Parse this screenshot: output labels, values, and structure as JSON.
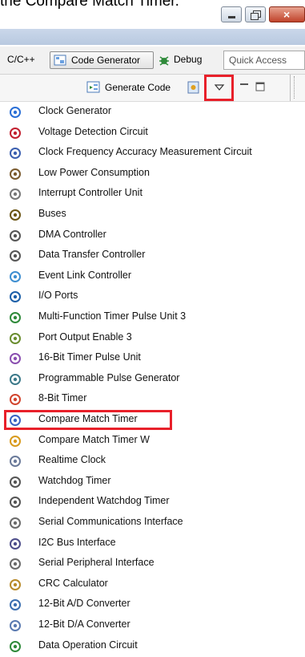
{
  "caption": "the Compare Match Timer.",
  "toolbar": {
    "perspective_cpp": "C/C++",
    "perspective_codegen": "Code Generator",
    "perspective_debug": "Debug",
    "quick_access": "Quick Access",
    "generate_code": "Generate Code"
  },
  "menu": {
    "items": [
      {
        "label": "Clock Generator",
        "icon": "clock-generator-icon",
        "color": "#2a6fd6"
      },
      {
        "label": "Voltage Detection Circuit",
        "icon": "voltage-detection-icon",
        "color": "#c21f2f"
      },
      {
        "label": "Clock Frequency Accuracy Measurement Circuit",
        "icon": "clock-frequency-icon",
        "color": "#3b5fb0"
      },
      {
        "label": "Low Power Consumption",
        "icon": "low-power-icon",
        "color": "#7a5a2e"
      },
      {
        "label": "Interrupt Controller Unit",
        "icon": "interrupt-controller-icon",
        "color": "#777777"
      },
      {
        "label": "Buses",
        "icon": "buses-icon",
        "color": "#6b5514"
      },
      {
        "label": "DMA Controller",
        "icon": "dma-controller-icon",
        "color": "#555555"
      },
      {
        "label": "Data Transfer Controller",
        "icon": "data-transfer-icon",
        "color": "#555555"
      },
      {
        "label": "Event Link Controller",
        "icon": "event-link-icon",
        "color": "#3e8ed0"
      },
      {
        "label": "I/O Ports",
        "icon": "io-ports-icon",
        "color": "#1c5fa8"
      },
      {
        "label": "Multi-Function Timer Pulse Unit 3",
        "icon": "mtu3-timer-icon",
        "color": "#2f8a3a"
      },
      {
        "label": "Port Output Enable 3",
        "icon": "port-output-icon",
        "color": "#6a8d2f"
      },
      {
        "label": "16-Bit Timer Pulse Unit",
        "icon": "tpu-timer-icon",
        "color": "#8a4fb0"
      },
      {
        "label": "Programmable Pulse Generator",
        "icon": "ppg-icon",
        "color": "#3c7a8a"
      },
      {
        "label": "8-Bit Timer",
        "icon": "8bit-timer-icon",
        "color": "#d2452e"
      },
      {
        "label": "Compare Match Timer",
        "icon": "cmt-timer-icon",
        "color": "#3a63c4"
      },
      {
        "label": "Compare Match Timer W",
        "icon": "cmtw-timer-icon",
        "color": "#d99a1c"
      },
      {
        "label": "Realtime Clock",
        "icon": "realtime-clock-icon",
        "color": "#6a7a9a"
      },
      {
        "label": "Watchdog Timer",
        "icon": "watchdog-icon",
        "color": "#555555"
      },
      {
        "label": "Independent Watchdog Timer",
        "icon": "independent-watchdog-icon",
        "color": "#555555"
      },
      {
        "label": "Serial Communications Interface",
        "icon": "sci-icon",
        "color": "#6b6b6b"
      },
      {
        "label": "I2C Bus Interface",
        "icon": "i2c-icon",
        "color": "#4d4d8a"
      },
      {
        "label": "Serial Peripheral Interface",
        "icon": "spi-icon",
        "color": "#6b6b6b"
      },
      {
        "label": "CRC Calculator",
        "icon": "crc-icon",
        "color": "#b88a2a"
      },
      {
        "label": "12-Bit A/D Converter",
        "icon": "ad-converter-icon",
        "color": "#3b6fb0"
      },
      {
        "label": "12-Bit D/A Converter",
        "icon": "da-converter-icon",
        "color": "#5a7ab0"
      },
      {
        "label": "Data Operation Circuit",
        "icon": "data-operation-icon",
        "color": "#2f8a3a"
      }
    ]
  }
}
